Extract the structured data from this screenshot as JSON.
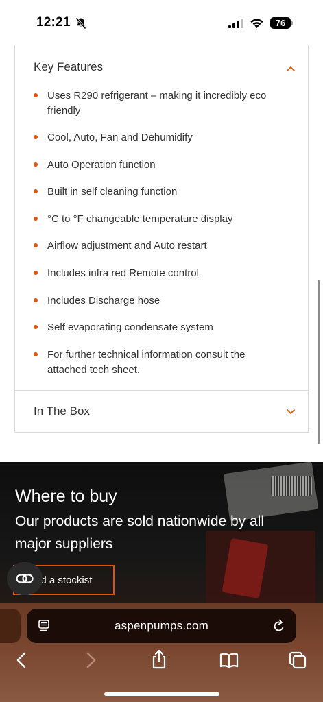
{
  "status_bar": {
    "time": "12:21",
    "battery": "76"
  },
  "key_features": {
    "title": "Key Features",
    "items": [
      "Uses R290 refrigerant – making it incredibly eco friendly",
      "Cool, Auto, Fan and Dehumidify",
      "Auto Operation function",
      "Built in self cleaning function",
      "°C to °F changeable temperature display",
      "Airflow adjustment and Auto restart",
      "Includes infra red Remote control",
      "Includes Discharge hose",
      "Self evaporating condensate system",
      "For further technical information consult the attached tech sheet."
    ]
  },
  "in_the_box": {
    "title": "In The Box"
  },
  "where_to_buy": {
    "heading": "Where to buy",
    "subheading": "Our products are sold nationwide by all major suppliers",
    "button_label": "nd a stockist"
  },
  "browser": {
    "url": "aspenpumps.com"
  },
  "colors": {
    "accent": "#e35205",
    "banner_bg": "#121212",
    "toolbar_bg": "#7a4630"
  },
  "icons": {
    "status": [
      "bell-slash-icon",
      "cellular-signal-icon",
      "wifi-icon",
      "battery-icon"
    ],
    "toolbar": [
      "back-icon",
      "forward-icon",
      "share-icon",
      "bookmarks-icon",
      "tabs-icon"
    ]
  }
}
